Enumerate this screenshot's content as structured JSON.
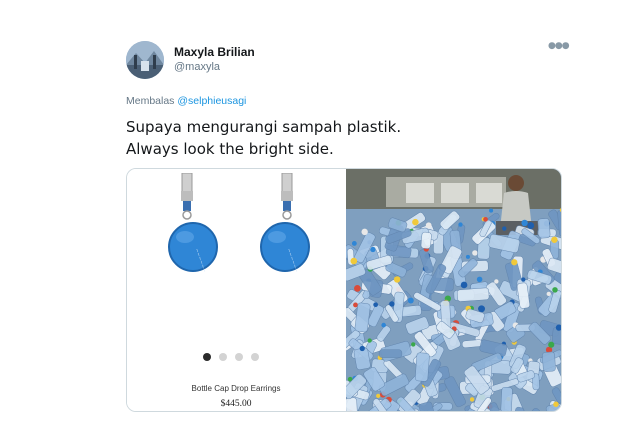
{
  "tweet": {
    "author_name": "Maxyla Brilian",
    "author_handle": "@maxyla",
    "replying_prefix": "Membalas",
    "replying_to": "@selphieusagi",
    "text": "Supaya mengurangi sampah plastik.\nAlways look the bright side.",
    "more_icon": "ellipsis-icon"
  },
  "media": {
    "product": {
      "name": "Bottle Cap Drop Earrings",
      "price": "$445.00",
      "carousel_dots": 4,
      "active_dot": 0
    },
    "photo": {
      "subject": "plastic-bottles-pile"
    }
  },
  "colors": {
    "link": "#1b95e0",
    "cap_blue": "#2f86d6",
    "secondary_text": "#657786"
  }
}
